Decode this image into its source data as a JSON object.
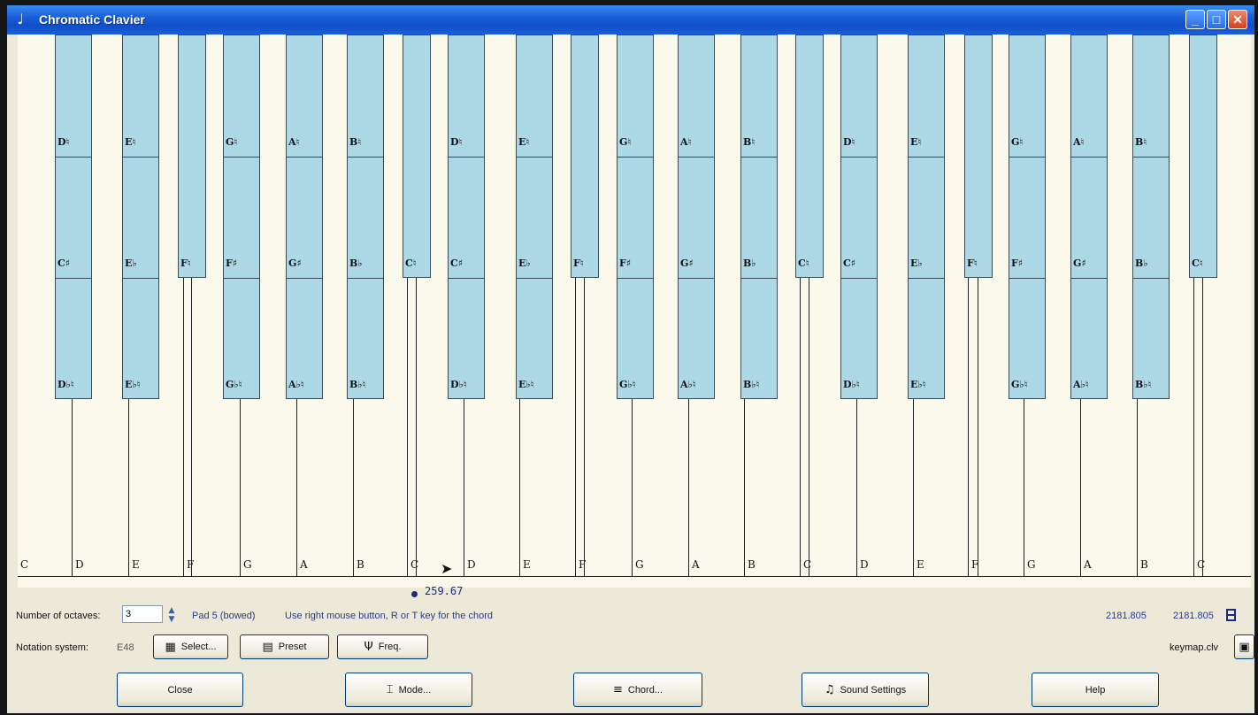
{
  "window": {
    "title": "Chromatic Clavier",
    "app_icon": "♩",
    "minimize_glyph": "_",
    "maximize_glyph": "□",
    "close_glyph": "✕"
  },
  "keyboard": {
    "white_keys": [
      "C",
      "D",
      "E",
      "F",
      "G",
      "A",
      "B",
      "C",
      "D",
      "E",
      "F",
      "G",
      "A",
      "B",
      "C",
      "D",
      "E",
      "F",
      "G",
      "A",
      "B",
      "C"
    ],
    "black_keys": [
      {
        "top": "D♮",
        "mid": "C♯",
        "low": "D♭♮"
      },
      {
        "top": "E♮",
        "mid": "E♭",
        "low": "E♭♮"
      },
      {
        "mid": "F♮"
      },
      {
        "top": "G♮",
        "mid": "F♯",
        "low": "G♭♮"
      },
      {
        "top": "A♮",
        "mid": "G♯",
        "low": "A♭♮"
      },
      {
        "top": "B♮",
        "mid": "B♭",
        "low": "B♭♮"
      },
      {
        "mid": "C♮"
      },
      {
        "top": "D♮",
        "mid": "C♯",
        "low": "D♭♮"
      },
      {
        "top": "E♮",
        "mid": "E♭",
        "low": "E♭♮"
      },
      {
        "mid": "F♮"
      },
      {
        "top": "G♮",
        "mid": "F♯",
        "low": "G♭♮"
      },
      {
        "top": "A♮",
        "mid": "G♯",
        "low": "A♭♮"
      },
      {
        "top": "B♮",
        "mid": "B♭",
        "low": "B♭♮"
      },
      {
        "mid": "C♮"
      },
      {
        "top": "D♮",
        "mid": "C♯",
        "low": "D♭♮"
      },
      {
        "top": "E♮",
        "mid": "E♭",
        "low": "E♭♮"
      },
      {
        "mid": "F♮"
      },
      {
        "top": "G♮",
        "mid": "F♯",
        "low": "G♭♮"
      },
      {
        "top": "A♮",
        "mid": "G♯",
        "low": "A♭♮"
      },
      {
        "top": "B♮",
        "mid": "B♭",
        "low": "B♭♮"
      },
      {
        "mid": "C♮"
      }
    ],
    "frequency_readout": "259.67"
  },
  "controls": {
    "octaves_label": "Number of octaves:",
    "octaves_value": "3",
    "pad_label": "Pad 5 (bowed)",
    "hint": "Use right mouse button, R or T key for the chord",
    "coord1": "2181.805",
    "coord2": "2181.805",
    "notation_label": "Notation system:",
    "notation_value": "E48",
    "select_label": "Select...",
    "preset_label": "Preset",
    "freq_label": "Freq.",
    "keymap_label": "keymap.clv"
  },
  "bottom_buttons": {
    "close": "Close",
    "mode": "Mode...",
    "chord": "Chord...",
    "sound_settings": "Sound Settings",
    "help": "Help"
  }
}
